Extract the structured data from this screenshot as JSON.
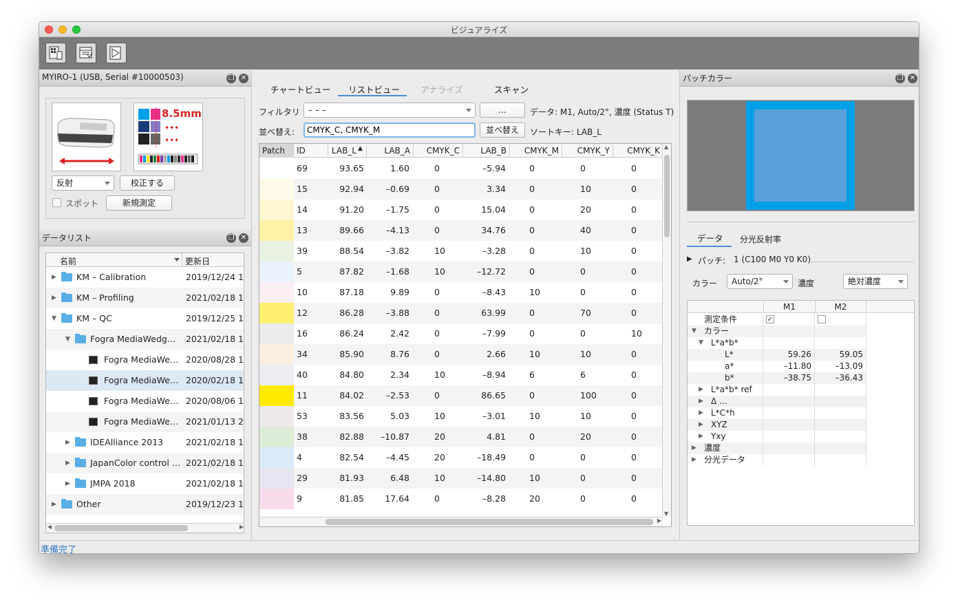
{
  "window": {
    "title": "ビジュアライズ"
  },
  "toolbar": {
    "buttons": [
      "device-icon",
      "list-icon",
      "chart-icon"
    ]
  },
  "device_panel": {
    "title": "MYIRO-1 (USB, Serial #10000503)",
    "chart_label": "8.5mm",
    "mode": "反射",
    "calibrate_label": "校正する",
    "spot_label": "スポット",
    "new_measure_label": "新規測定"
  },
  "datalist": {
    "title": "データリスト",
    "col_name": "名前",
    "col_date": "更新日",
    "rows": [
      {
        "name": "KM – Calibration",
        "date": "2019/12/24 1",
        "level": 0,
        "type": "folder",
        "tri": "▶"
      },
      {
        "name": "KM – Profiling",
        "date": "2021/02/18 1",
        "level": 0,
        "type": "folder",
        "tri": "▶"
      },
      {
        "name": "KM – QC",
        "date": "2019/12/25 1",
        "level": 0,
        "type": "folder",
        "tri": "▼"
      },
      {
        "name": "Fogra MediaWedge ...",
        "date": "2021/02/18 1",
        "level": 1,
        "type": "folder",
        "tri": "▼"
      },
      {
        "name": "Fogra MediaWed...",
        "date": "2020/08/28 1",
        "level": 2,
        "type": "doc",
        "tri": ""
      },
      {
        "name": "Fogra MediaWed...",
        "date": "2020/02/18 1",
        "level": 2,
        "type": "doc",
        "tri": ""
      },
      {
        "name": "Fogra MediaWed...",
        "date": "2020/08/06 1",
        "level": 2,
        "type": "doc",
        "tri": ""
      },
      {
        "name": "Fogra MediaWed...",
        "date": "2021/01/13 2",
        "level": 2,
        "type": "doc",
        "tri": ""
      },
      {
        "name": "IDEAlliance 2013",
        "date": "2021/02/18 1",
        "level": 1,
        "type": "folder",
        "tri": "▶"
      },
      {
        "name": "JapanColor control s...",
        "date": "2021/02/18 1",
        "level": 1,
        "type": "folder",
        "tri": "▶"
      },
      {
        "name": "JMPA 2018",
        "date": "2021/02/18 1",
        "level": 1,
        "type": "folder",
        "tri": "▶"
      },
      {
        "name": "Other",
        "date": "2019/12/23 1",
        "level": 0,
        "type": "folder",
        "tri": "▶"
      }
    ],
    "selected_index": 5
  },
  "center": {
    "tabs": [
      "チャートビュー",
      "リストビュー",
      "アナライズ",
      "スキャン"
    ],
    "active_tab": 1,
    "filter_label": "フィルタリ",
    "filter_value": "– – –",
    "more_label": "...",
    "data_info": "データ: M1, Auto/2°, 濃度 (Status T)",
    "sort_label": "並べ替え:",
    "sort_value": "CMYK_C, CMYK_M",
    "sort_button": "並べ替え",
    "sort_key": "ソートキー: LAB_L",
    "columns": [
      "Patch",
      "ID",
      "LAB_L",
      "LAB_A",
      "CMYK_C",
      "LAB_B",
      "CMYK_M",
      "CMYK_Y",
      "CMYK_K"
    ],
    "rows": [
      {
        "color": "#ffffff",
        "id": "69",
        "L": "93.65",
        "a": "1.60",
        "c": "0",
        "b": "–5.94",
        "m": "0",
        "y": "0",
        "k": "0"
      },
      {
        "color": "#fffbe8",
        "id": "15",
        "L": "92.94",
        "a": "–0.69",
        "c": "0",
        "b": "3.34",
        "m": "0",
        "y": "10",
        "k": "0"
      },
      {
        "color": "#fff6d2",
        "id": "14",
        "L": "91.20",
        "a": "–1.75",
        "c": "0",
        "b": "15.04",
        "m": "0",
        "y": "20",
        "k": "0"
      },
      {
        "color": "#fff2a6",
        "id": "13",
        "L": "89.66",
        "a": "–4.13",
        "c": "0",
        "b": "34.76",
        "m": "0",
        "y": "40",
        "k": "0"
      },
      {
        "color": "#eaf2e4",
        "id": "39",
        "L": "88.54",
        "a": "–3.82",
        "c": "10",
        "b": "–3.28",
        "m": "0",
        "y": "10",
        "k": "0"
      },
      {
        "color": "#eaf3fb",
        "id": "5",
        "L": "87.82",
        "a": "–1.68",
        "c": "10",
        "b": "–12.72",
        "m": "0",
        "y": "0",
        "k": "0"
      },
      {
        "color": "#fbeef5",
        "id": "10",
        "L": "87.18",
        "a": "9.89",
        "c": "0",
        "b": "–8.43",
        "m": "10",
        "y": "0",
        "k": "0"
      },
      {
        "color": "#ffef70",
        "id": "12",
        "L": "86.28",
        "a": "–3.88",
        "c": "0",
        "b": "63.99",
        "m": "0",
        "y": "70",
        "k": "0"
      },
      {
        "color": "#ebebeb",
        "id": "16",
        "L": "86.24",
        "a": "2.42",
        "c": "0",
        "b": "–7.99",
        "m": "0",
        "y": "0",
        "k": "10"
      },
      {
        "color": "#fcefe2",
        "id": "34",
        "L": "85.90",
        "a": "8.76",
        "c": "0",
        "b": "2.66",
        "m": "10",
        "y": "10",
        "k": "0"
      },
      {
        "color": "#eceef2",
        "id": "40",
        "L": "84.80",
        "a": "2.34",
        "c": "10",
        "b": "–8.94",
        "m": "6",
        "y": "6",
        "k": "0"
      },
      {
        "color": "#ffea00",
        "id": "11",
        "L": "84.02",
        "a": "–2.53",
        "c": "0",
        "b": "86.65",
        "m": "0",
        "y": "100",
        "k": "0"
      },
      {
        "color": "#ede9ea",
        "id": "53",
        "L": "83.56",
        "a": "5.03",
        "c": "10",
        "b": "–3.01",
        "m": "10",
        "y": "10",
        "k": "0"
      },
      {
        "color": "#dcecd6",
        "id": "38",
        "L": "82.88",
        "a": "–10.87",
        "c": "20",
        "b": "4.81",
        "m": "0",
        "y": "20",
        "k": "0"
      },
      {
        "color": "#d9ebf9",
        "id": "4",
        "L": "82.54",
        "a": "–4.45",
        "c": "20",
        "b": "–18.49",
        "m": "0",
        "y": "0",
        "k": "0"
      },
      {
        "color": "#e6e6f3",
        "id": "29",
        "L": "81.93",
        "a": "6.48",
        "c": "10",
        "b": "–14.80",
        "m": "10",
        "y": "0",
        "k": "0"
      },
      {
        "color": "#f8dcec",
        "id": "9",
        "L": "81.85",
        "a": "17.64",
        "c": "0",
        "b": "–8.28",
        "m": "20",
        "y": "0",
        "k": "0"
      }
    ]
  },
  "patch_panel": {
    "title": "パッチカラー",
    "outer_color": "#00a0e8",
    "inner_color": "#5aa0d8",
    "tabs": [
      "データ",
      "分光反射率"
    ],
    "patch_label": "パッチ:",
    "patch_value": "1 (C100 M0 Y0 K0)",
    "color_label": "カラー",
    "color_value": "Auto/2°",
    "density_label": "濃度",
    "density_value": "絶対濃度",
    "col_m1": "M1",
    "col_m2": "M2",
    "rows": [
      {
        "label": "測定条件",
        "indent": 1,
        "tri": "",
        "m1": "",
        "m2": "",
        "check": true
      },
      {
        "label": "カラー",
        "indent": 0,
        "tri": "▼",
        "m1": "",
        "m2": ""
      },
      {
        "label": "L*a*b*",
        "indent": 1,
        "tri": "▼",
        "m1": "",
        "m2": ""
      },
      {
        "label": "L*",
        "indent": 3,
        "tri": "",
        "m1": "59.26",
        "m2": "59.05"
      },
      {
        "label": "a*",
        "indent": 3,
        "tri": "",
        "m1": "–11.80",
        "m2": "–13.09"
      },
      {
        "label": "b*",
        "indent": 3,
        "tri": "",
        "m1": "–38.75",
        "m2": "–36.43"
      },
      {
        "label": "L*a*b* ref",
        "indent": 1,
        "tri": "▶",
        "m1": "",
        "m2": ""
      },
      {
        "label": "Δ ...",
        "indent": 1,
        "tri": "▶",
        "m1": "",
        "m2": ""
      },
      {
        "label": "L*C*h",
        "indent": 1,
        "tri": "▶",
        "m1": "",
        "m2": ""
      },
      {
        "label": "XYZ",
        "indent": 1,
        "tri": "▶",
        "m1": "",
        "m2": ""
      },
      {
        "label": "Yxy",
        "indent": 1,
        "tri": "▶",
        "m1": "",
        "m2": ""
      },
      {
        "label": "濃度",
        "indent": 0,
        "tri": "▶",
        "m1": "",
        "m2": ""
      },
      {
        "label": "分光データ",
        "indent": 0,
        "tri": "▶",
        "m1": "",
        "m2": ""
      }
    ]
  },
  "status": {
    "text": "準備完了"
  }
}
